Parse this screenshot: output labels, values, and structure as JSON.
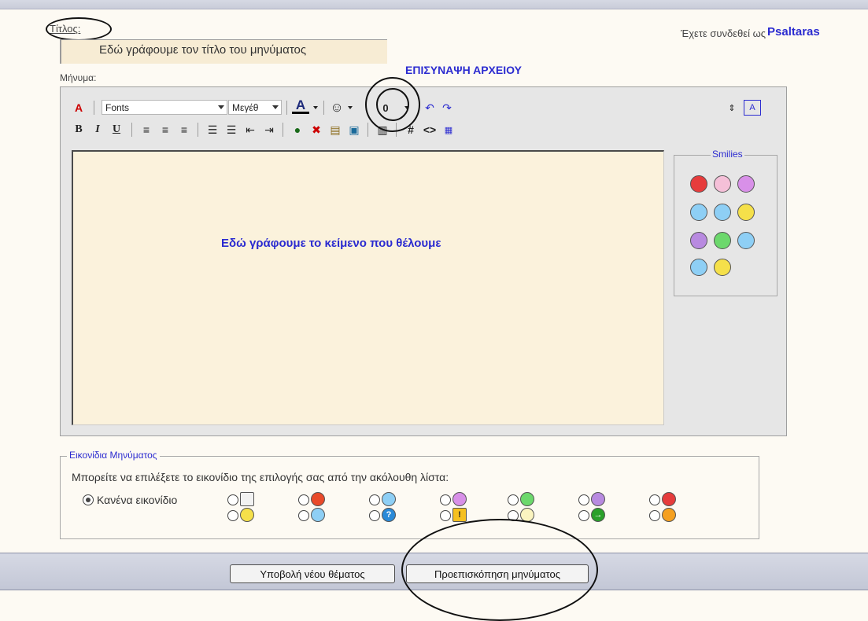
{
  "header": {
    "title_label": "Τίτλος:",
    "logged_in_text": "Έχετε συνδεθεί ως",
    "username": "Psaltaras"
  },
  "title_field": {
    "value": "Εδώ γράφουμε τον τίτλο του μηνύματος"
  },
  "attach_caption": "ΕΠΙΣΥΝΑΨΗ ΑΡΧΕΙΟΥ",
  "message_label": "Μήνυμα:",
  "toolbar": {
    "font_select": "Fonts",
    "size_select": "Μεγέθ",
    "font_color_glyph": "A",
    "bold": "B",
    "italic": "I",
    "underline": "U",
    "hash": "#",
    "code": "<>"
  },
  "editor": {
    "content": "Εδώ γράφουμε το κείμενο που θέλουμε"
  },
  "smilies": {
    "legend": "Smilies",
    "items": [
      "angry-smiley",
      "wink-smiley",
      "laugh-smiley",
      "confused-smiley",
      "happy-smiley",
      "smile-smiley",
      "sad-smiley",
      "grin-smiley",
      "cool-smiley",
      "glasses-smiley",
      "shock-smiley"
    ]
  },
  "post_icons": {
    "legend": "Εικονίδια Μηνύματος",
    "hint": "Μπορείτε να επιλέξετε το εικονίδιο της επιλογής σας από την ακόλουθη λίστα:",
    "none_label": "Κανένα εικονίδιο",
    "row1": [
      "document-icon",
      "thumbs-down-icon",
      "smile-icon",
      "laugh-icon",
      "grin-icon",
      "sad-icon",
      "angry-icon"
    ],
    "row2": [
      "happy-icon",
      "cool-icon",
      "question-icon",
      "warning-icon",
      "lightbulb-icon",
      "arrow-right-icon",
      "thumbs-up-icon"
    ]
  },
  "buttons": {
    "submit": "Υποβολή νέου θέματος",
    "preview": "Προεπισκόπηση μηνύματος"
  },
  "colors": {
    "accent_blue": "#2b2bd0",
    "editor_bg": "#fbf2dc",
    "frame_bg": "#e6e6e6"
  }
}
